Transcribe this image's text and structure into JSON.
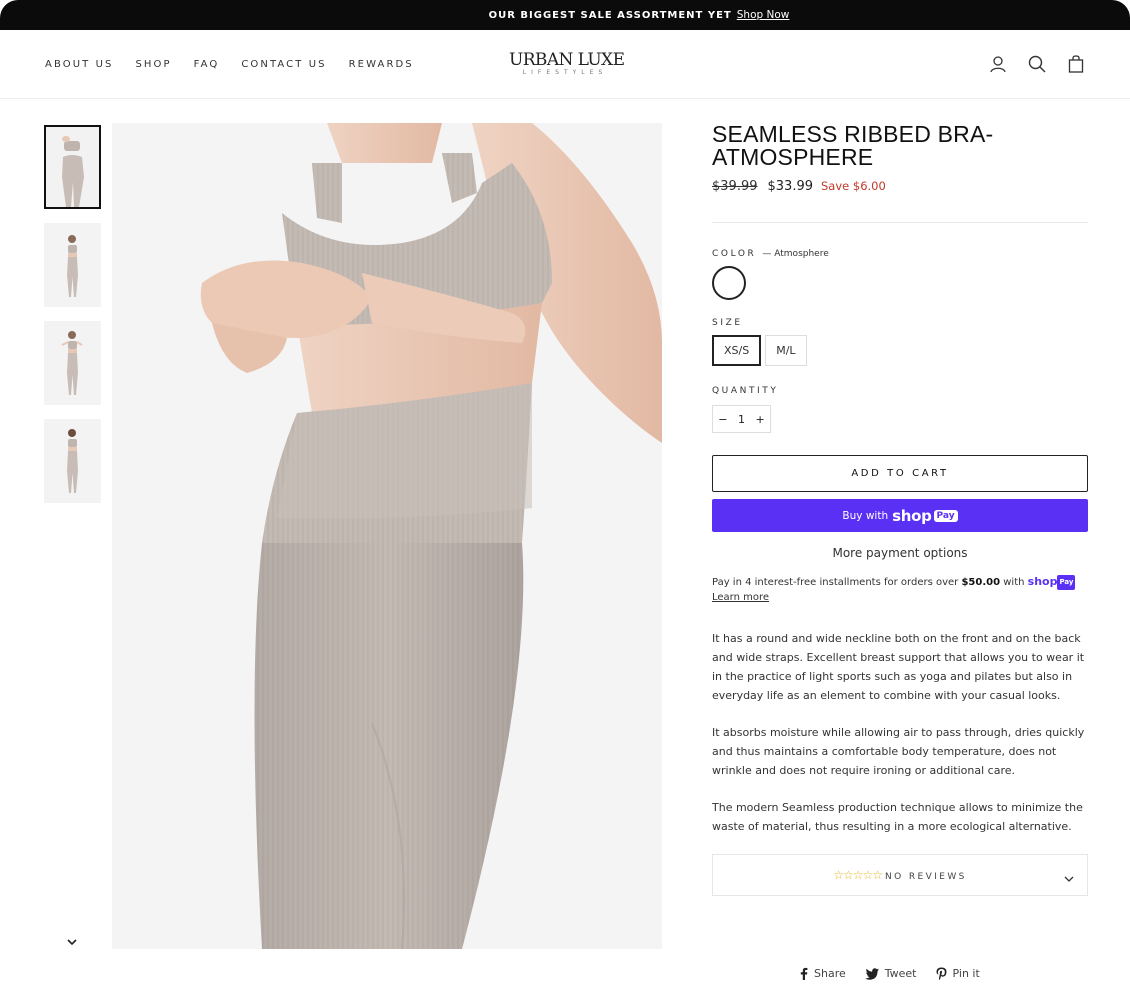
{
  "announcement": {
    "text": "OUR BIGGEST SALE ASSORTMENT YET",
    "link": "Shop Now"
  },
  "nav": {
    "items": [
      "ABOUT US",
      "SHOP",
      "FAQ",
      "CONTACT US",
      "REWARDS"
    ]
  },
  "logo": {
    "main": "URBAN LUXE",
    "sub": "LIFESTYLES"
  },
  "header_icons": [
    "user-icon",
    "search-icon",
    "bag-icon"
  ],
  "product": {
    "title": "SEAMLESS RIBBED BRA-ATMOSPHERE",
    "price_old": "$39.99",
    "price_now": "$33.99",
    "save": "Save $6.00",
    "color_label": "COLOR",
    "color_value": "— Atmosphere",
    "size_label": "SIZE",
    "sizes": [
      "XS/S",
      "M/L"
    ],
    "selected_size": "XS/S",
    "quantity_label": "QUANTITY",
    "quantity": "1",
    "minus": "−",
    "plus": "+",
    "add_to_cart": "ADD TO CART",
    "shop_pay_prefix": "Buy with",
    "shop_pay_word": "shop",
    "shop_pay_badge": "Pay",
    "more_payment": "More payment options",
    "installments_pre": "Pay in 4 interest-free installments for orders over",
    "installments_amount": "$50.00",
    "installments_with": "with",
    "installments_shop": "shop",
    "installments_pay": "Pay",
    "learn_more": "Learn more",
    "description": [
      "It has a round and wide neckline both on the front and on the back and wide straps. Excellent breast support that allows you to wear it in the practice of light sports such as yoga and pilates but also in everyday life as an element to combine with your casual looks.",
      "It absorbs moisture while allowing air to pass through, dries quickly and thus maintains a comfortable body temperature, does not wrinkle and does not require ironing or additional care.",
      "The modern Seamless production technique allows to minimize the waste of material, thus resulting in a more ecological alternative."
    ],
    "stars": "☆☆☆☆☆",
    "reviews_text": "NO REVIEWS"
  },
  "share": {
    "share": "Share",
    "tweet": "Tweet",
    "pin": "Pin it"
  },
  "colors": {
    "shop_pay": "#5a31f4",
    "sale": "#c0392b",
    "fabric": "#c4bab4"
  }
}
